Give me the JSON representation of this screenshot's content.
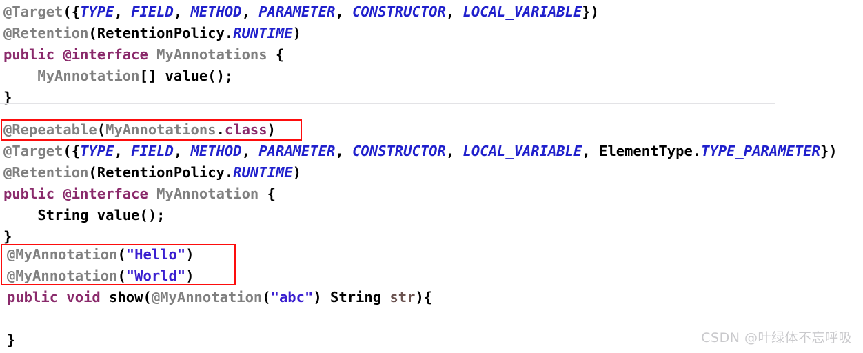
{
  "page": {
    "background": "#ffffff",
    "highlight_color": "#fd0d0d",
    "separator_color": "#e3e3e6"
  },
  "watermark": {
    "text": "CSDN @叶绿体不忘呼吸"
  },
  "palette": {
    "plain": "#000000",
    "annotation": "#808080",
    "type": "#808080",
    "keyword": "#8A2A6B",
    "enum_constant": "#2020CC",
    "string": "#3A1FD0",
    "parameter": "#6B5350"
  },
  "blocks": [
    {
      "name": "my-annotations-container-declaration",
      "lines": {
        "l1": {
          "t1": "@Target",
          "t2": "({",
          "t3": "TYPE",
          "t4": ", ",
          "t5": "FIELD",
          "t6": ", ",
          "t7": "METHOD",
          "t8": ", ",
          "t9": "PARAMETER",
          "t10": ", ",
          "t11": "CONSTRUCTOR",
          "t12": ", ",
          "t13": "LOCAL_VARIABLE",
          "t14": "})"
        },
        "l2": {
          "t1": "@Retention",
          "t2": "(",
          "t3": "RetentionPolicy",
          "t4": ".",
          "t5": "RUNTIME",
          "t6": ")"
        },
        "l3": {
          "t1": "public @interface",
          "t2": " ",
          "t3": "MyAnnotations",
          "t4": " {"
        },
        "l4": {
          "t1": "    MyAnnotation",
          "t2": "[] value();"
        },
        "l5": {
          "t1": "}"
        }
      }
    },
    {
      "name": "my-annotation-declaration",
      "lines": {
        "l1": {
          "t1": "@Repeatable",
          "t2": "(",
          "t3": "MyAnnotations",
          "t4": ".",
          "t5": "class",
          "t6": ")"
        },
        "l2": {
          "t1": "@Target",
          "t2": "({",
          "t3": "TYPE",
          "t4": ", ",
          "t5": "FIELD",
          "t6": ", ",
          "t7": "METHOD",
          "t8": ", ",
          "t9": "PARAMETER",
          "t10": ", ",
          "t11": "CONSTRUCTOR",
          "t12": ", ",
          "t13": "LOCAL_VARIABLE",
          "t14": ", ",
          "t15": "ElementType",
          "t16": ".",
          "t17": "TYPE_PARAMETER",
          "t18": "})"
        },
        "l3": {
          "t1": "@Retention",
          "t2": "(",
          "t3": "RetentionPolicy",
          "t4": ".",
          "t5": "RUNTIME",
          "t6": ")"
        },
        "l4": {
          "t1": "public @interface",
          "t2": " ",
          "t3": "MyAnnotation",
          "t4": " {"
        },
        "l5": {
          "t1": "    String value();"
        },
        "l6": {
          "t1": "}"
        }
      }
    },
    {
      "name": "repeatable-annotation-usage",
      "lines": {
        "l1": {
          "t1": "@MyAnnotation",
          "t2": "(",
          "t3": "\"Hello\"",
          "t4": ")"
        },
        "l2": {
          "t1": "@MyAnnotation",
          "t2": "(",
          "t3": "\"World\"",
          "t4": ")"
        },
        "l3": {
          "t1": "public void",
          "t2": " show(",
          "t3": "@MyAnnotation",
          "t4": "(",
          "t5": "\"abc\"",
          "t6": ") String ",
          "t7": "str",
          "t8": "){"
        },
        "l4": {
          "t1": ""
        },
        "l5": {
          "t1": "}"
        }
      }
    }
  ],
  "highlights": [
    {
      "name": "highlight-box-repeatable"
    },
    {
      "name": "highlight-box-repeated-usage"
    }
  ]
}
